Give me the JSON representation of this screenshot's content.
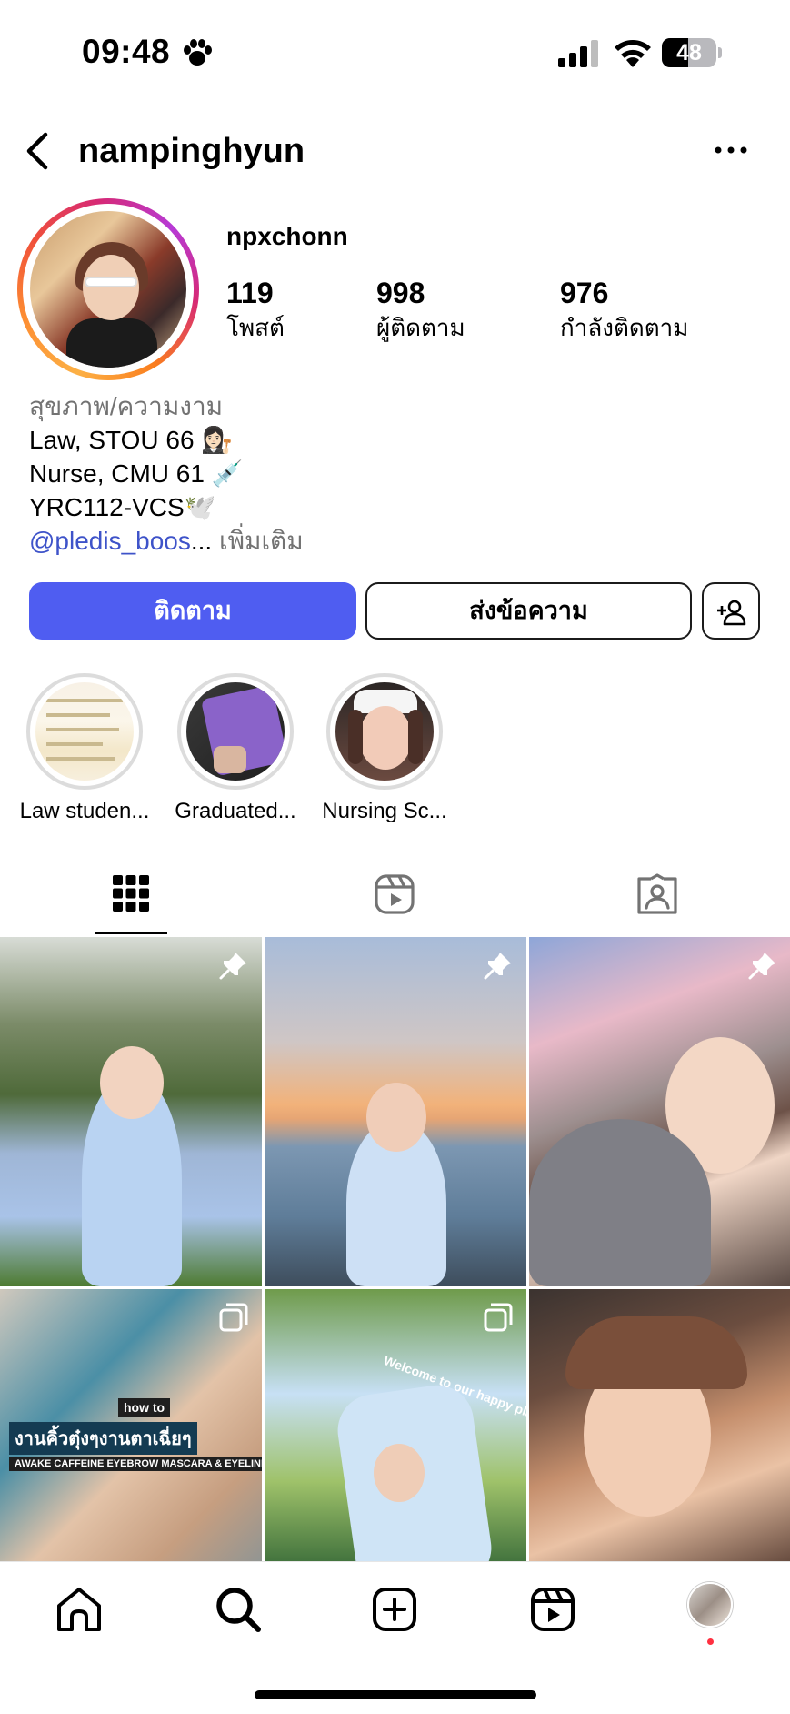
{
  "status_bar": {
    "time": "09:48",
    "battery": "48",
    "battery_level": 0.48
  },
  "header": {
    "username": "namping­hyun"
  },
  "profile": {
    "display_name": "npxchonn",
    "stats": [
      {
        "value": "119",
        "label": "โพสต์"
      },
      {
        "value": "998",
        "label": "ผู้ติดตาม"
      },
      {
        "value": "976",
        "label": "กำลังติดตาม"
      }
    ],
    "bio": {
      "category": "สุขภาพ/ความงาม",
      "lines": [
        "Law, STOU 66 👩🏻‍⚖️",
        "Nurse, CMU 61 💉",
        "YRC112-VCS🕊️"
      ],
      "link": "@pledis_boos",
      "ellipsis": "...",
      "more": "เพิ่มเติม"
    }
  },
  "actions": {
    "follow": "ติดตาม",
    "message": "ส่งข้อความ"
  },
  "highlights": [
    {
      "label": "Law studen..."
    },
    {
      "label": "Graduated..."
    },
    {
      "label": "Nursing Sc..."
    }
  ],
  "posts": [
    {
      "pinned": true,
      "type": "photo"
    },
    {
      "pinned": true,
      "type": "photo"
    },
    {
      "pinned": true,
      "type": "photo"
    },
    {
      "pinned": false,
      "type": "carousel",
      "texts": [
        "how to",
        "งานคิ้วตุ๋งๆงานตาเฉี่ยๆ",
        "AWAKE CAFFEINE EYEBROW MASCARA & EYELINER"
      ]
    },
    {
      "pinned": false,
      "type": "carousel",
      "texts": [
        "Welcome to our happy place"
      ]
    },
    {
      "pinned": false,
      "type": "photo"
    }
  ],
  "colors": {
    "follow_button": "#4f5df1",
    "link": "#3e53c9",
    "notification_dot": "#ff3040"
  },
  "icons": {
    "tabs": [
      "grid-icon",
      "reels-icon",
      "tagged-icon"
    ],
    "nav": [
      "home-icon",
      "search-icon",
      "create-icon",
      "reels-icon",
      "profile-avatar"
    ]
  }
}
